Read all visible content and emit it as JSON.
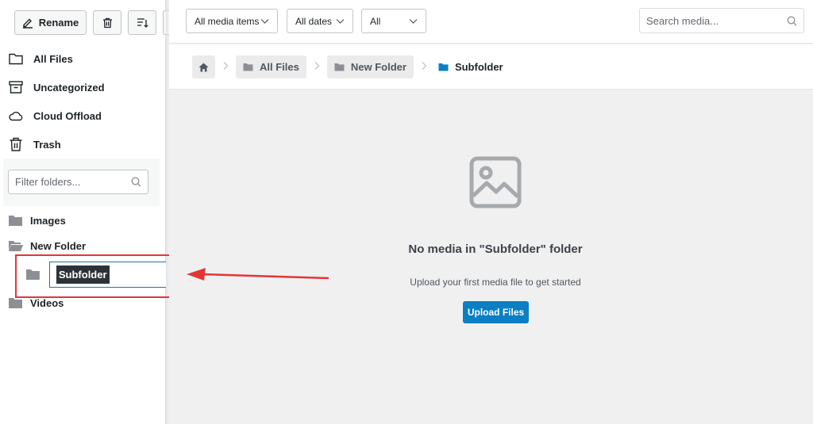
{
  "toolbar": {
    "rename_label": "Rename",
    "delete_icon": "trash-icon",
    "sort_icon": "sort-icon"
  },
  "nav": {
    "items": [
      {
        "label": "All Files",
        "icon": "folder-outline-icon"
      },
      {
        "label": "Uncategorized",
        "icon": "archive-icon"
      },
      {
        "label": "Cloud Offload",
        "icon": "cloud-icon"
      },
      {
        "label": "Trash",
        "icon": "trash-icon"
      }
    ]
  },
  "folder_filter": {
    "placeholder": "Filter folders..."
  },
  "tree": {
    "images": "Images",
    "new_folder": "New Folder",
    "subfolder_editing_value": "Subfolder",
    "videos": "Videos"
  },
  "topbar": {
    "media_type": "All media items",
    "dates": "All dates",
    "third": "All",
    "search_placeholder": "Search media..."
  },
  "breadcrumb": {
    "items": [
      "All Files",
      "New Folder",
      "Subfolder"
    ]
  },
  "empty_state": {
    "title": "No media in \"Subfolder\" folder",
    "subtitle": "Upload your first media file to get started",
    "button": "Upload Files"
  },
  "colors": {
    "accent": "#0a7fc4",
    "annotation": "#e23636",
    "folder": "#8c8f94",
    "current_folder": "#0a7fc4"
  }
}
